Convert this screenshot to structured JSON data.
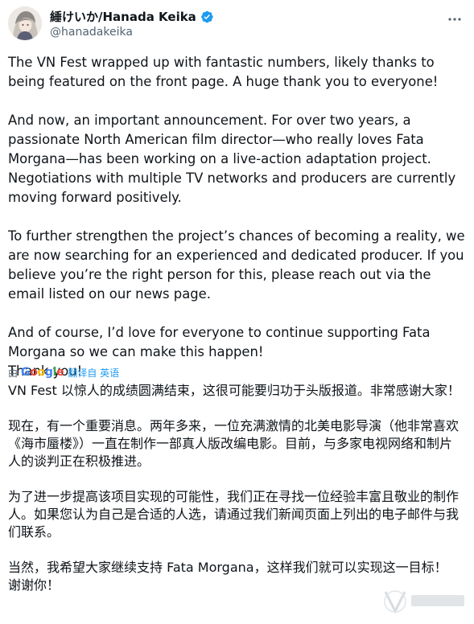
{
  "author": {
    "display_name": "綞けいか/Hanada Keika",
    "handle": "@hanadakeika"
  },
  "tweet": {
    "paragraphs": [
      "The VN Fest wrapped up with fantastic numbers, likely thanks to being featured on the front page. A huge thank you to everyone!",
      "And now, an important announcement. For over two years, a passionate North American film director—who really loves Fata Morgana—has been working on a live-action adaptation project. Negotiations with multiple TV networks and producers are currently moving forward positively.",
      "To further strengthen the project’s chances of becoming a reality, we are now searching for an experienced and dedicated producer. If you believe you’re the right person for this, please reach out via the email listed on our news page.",
      "And of course, I’d love for everyone to continue supporting Fata Morgana so we can make this happen!"
    ],
    "closing": "Thank you!"
  },
  "translation": {
    "by_label": "由",
    "google": "Google",
    "action_label": "翻译自 英语",
    "paragraphs": [
      "VN Fest 以惊人的成绩圆满结束，这很可能要归功于头版报道。非常感谢大家！",
      "现在，有一个重要消息。两年多来，一位充满激情的北美电影导演（他非常喜欢《海市蜃楼》）一直在制作一部真人版改编电影。目前，与多家电视网络和制片人的谈判正在积极推进。",
      "为了进一步提高该项目实现的可能性，我们正在寻找一位经验丰富且敬业的制作人。如果您认为自己是合适的人选，请通过我们新闻页面上列出的电子邮件与我们联系。",
      "当然，我希望大家继续支持 Fata Morgana，这样我们就可以实现这一目标！"
    ],
    "closing": "谢谢你！"
  },
  "colors": {
    "verified": "#1d9bf0",
    "link": "#1d9bf0",
    "secondary_text": "#536471"
  },
  "icons": {
    "verified": "verified-badge-icon",
    "more": "more-options-icon",
    "avatar": "avatar"
  }
}
